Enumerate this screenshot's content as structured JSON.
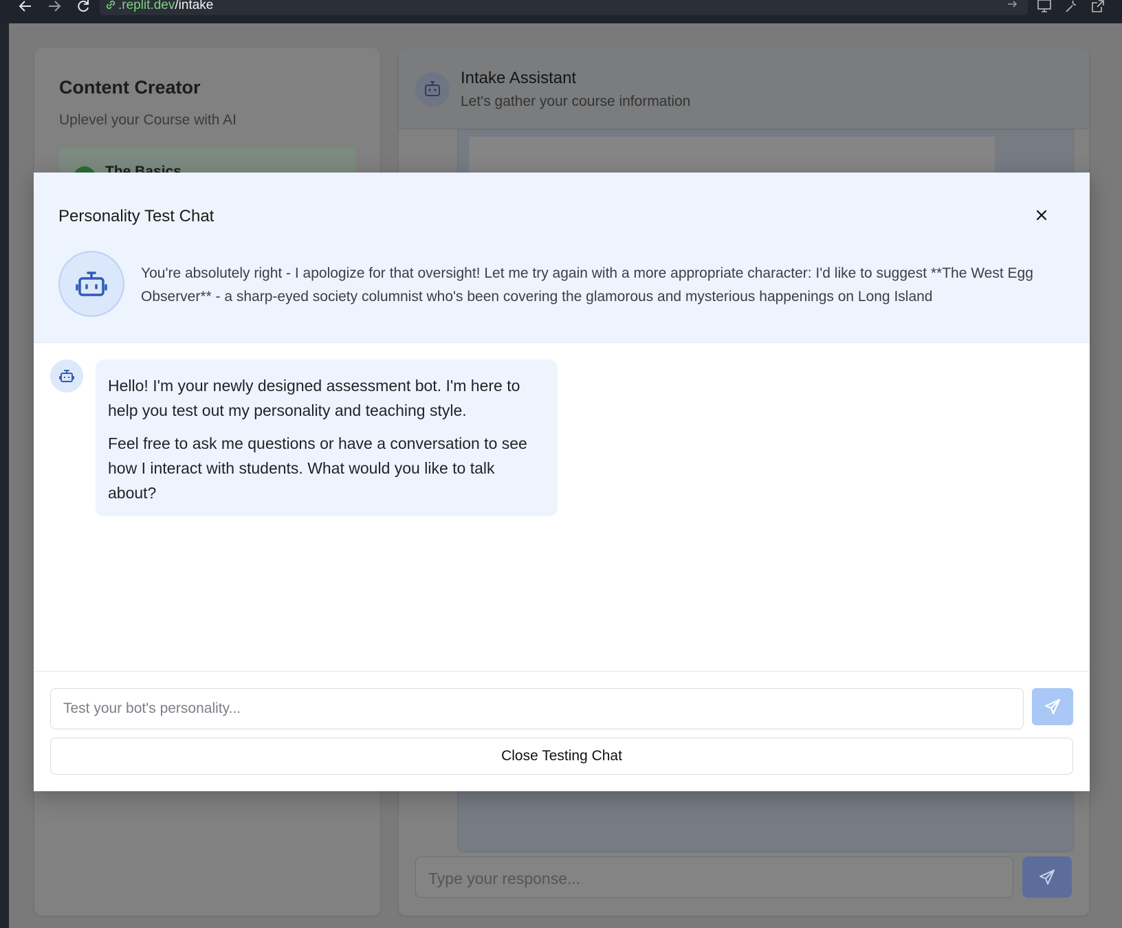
{
  "browser": {
    "url_host": ".replit.dev",
    "url_path": "/intake"
  },
  "background": {
    "left_panel": {
      "title": "Content Creator",
      "subtitle": "Uplevel your Course with AI",
      "section_label": "The Basics"
    },
    "right_panel": {
      "title": "Intake Assistant",
      "subtitle": "Let's gather your course information",
      "input_placeholder": "Type your response..."
    }
  },
  "modal": {
    "title": "Personality Test Chat",
    "persona_description": "You're absolutely right - I apologize for that oversight! Let me try again with a more appropriate character: I'd like to suggest **The West Egg Observer** - a sharp-eyed society columnist who's been covering the glamorous and mysterious happenings on Long Island",
    "messages": [
      {
        "role": "bot",
        "paragraphs": [
          "Hello! I'm your newly designed assessment bot. I'm here to help you test out my personality and teaching style.",
          "Feel free to ask me questions or have a conversation to see how I interact with students. What would you like to talk about?"
        ]
      }
    ],
    "input_placeholder": "Test your bot's personality...",
    "close_button_label": "Close Testing Chat"
  },
  "colors": {
    "accent": "#2f5bb7",
    "modal_header_bg": "#eef4fd",
    "send_button_bg": "#a9c8f5"
  }
}
